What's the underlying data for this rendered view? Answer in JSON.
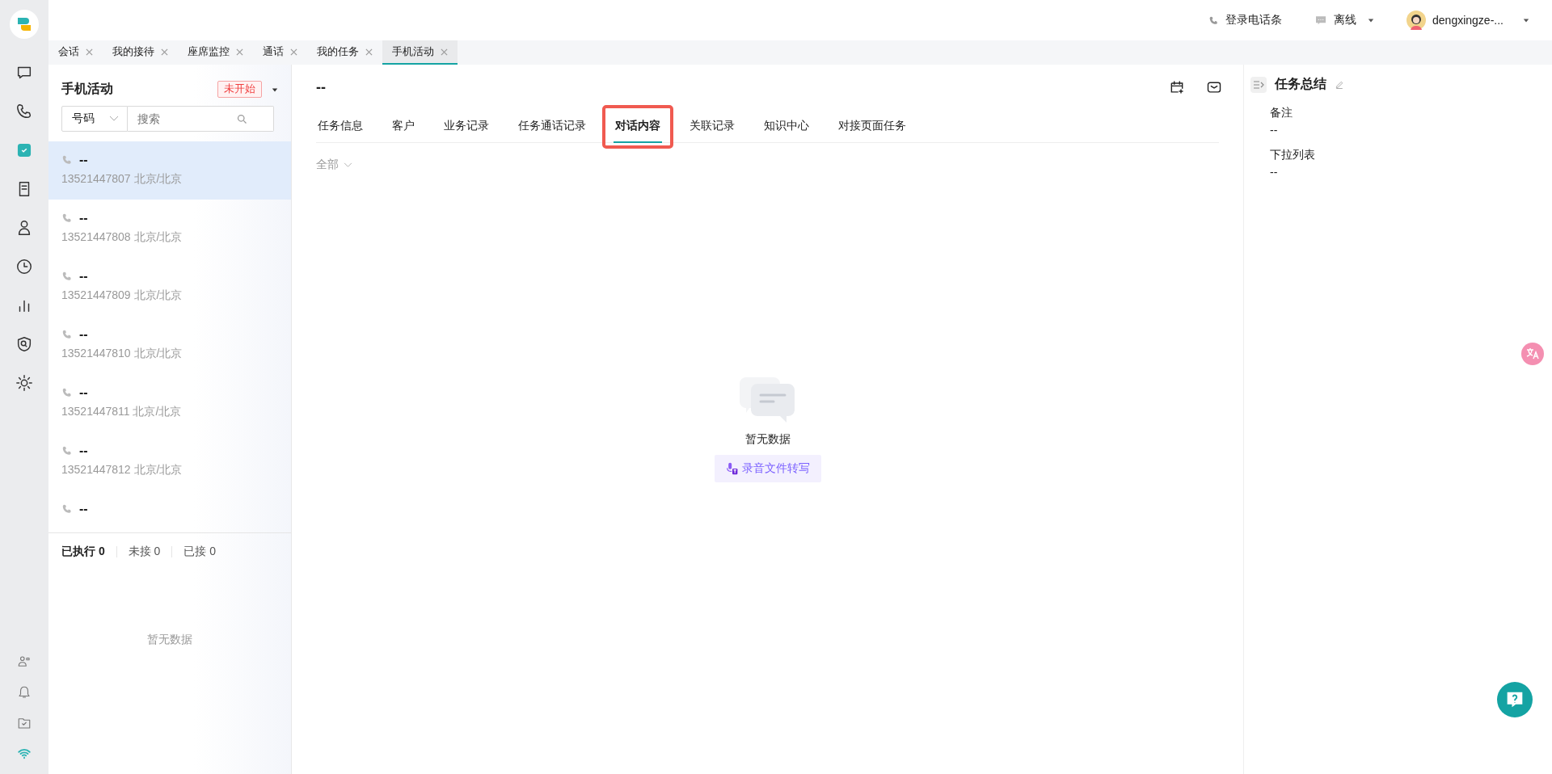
{
  "rail": {
    "items": [
      {
        "kind": "chat",
        "selected": false
      },
      {
        "kind": "phone",
        "selected": false
      },
      {
        "kind": "task",
        "selected": true
      },
      {
        "kind": "document",
        "selected": false
      },
      {
        "kind": "user",
        "selected": false
      },
      {
        "kind": "clock",
        "selected": false
      },
      {
        "kind": "chart",
        "selected": false
      },
      {
        "kind": "shield",
        "selected": false
      },
      {
        "kind": "gear",
        "selected": false
      }
    ],
    "bottom_items": [
      {
        "kind": "user-card"
      },
      {
        "kind": "bell"
      },
      {
        "kind": "folder"
      },
      {
        "kind": "wifi"
      }
    ]
  },
  "top_bar": {
    "phone_login": "登录电话条",
    "status": "离线",
    "user": "dengxingze-..."
  },
  "page_tabs": [
    {
      "label": "会话",
      "selected": false
    },
    {
      "label": "我的接待",
      "selected": false
    },
    {
      "label": "座席监控",
      "selected": false
    },
    {
      "label": "通话",
      "selected": false
    },
    {
      "label": "我的任务",
      "selected": false
    },
    {
      "label": "手机活动",
      "selected": true
    }
  ],
  "list_panel": {
    "title": "手机活动",
    "status_badge": "未开始",
    "search": {
      "type_select": "号码",
      "placeholder": "搜索"
    },
    "items": [
      {
        "title": "--",
        "subtitle": "13521447807 北京/北京",
        "selected": true
      },
      {
        "title": "--",
        "subtitle": "13521447808 北京/北京",
        "selected": false
      },
      {
        "title": "--",
        "subtitle": "13521447809 北京/北京",
        "selected": false
      },
      {
        "title": "--",
        "subtitle": "13521447810 北京/北京",
        "selected": false
      },
      {
        "title": "--",
        "subtitle": "13521447811 北京/北京",
        "selected": false
      },
      {
        "title": "--",
        "subtitle": "13521447812 北京/北京",
        "selected": false
      },
      {
        "title": "--",
        "selected": false
      }
    ],
    "stats": [
      {
        "label": "已执行 0",
        "selected": true
      },
      {
        "label": "未接 0",
        "selected": false
      },
      {
        "label": "已接 0",
        "selected": false
      }
    ],
    "empty_text": "暂无数据"
  },
  "main": {
    "title": "--",
    "tabs": [
      {
        "label": "任务信息",
        "selected": false,
        "highlighted": false
      },
      {
        "label": "客户",
        "selected": false,
        "highlighted": false
      },
      {
        "label": "业务记录",
        "selected": false,
        "highlighted": false
      },
      {
        "label": "任务通话记录",
        "selected": false,
        "highlighted": false
      },
      {
        "label": "对话内容",
        "selected": true,
        "highlighted": true
      },
      {
        "label": "关联记录",
        "selected": false,
        "highlighted": false
      },
      {
        "label": "知识中心",
        "selected": false,
        "highlighted": false
      },
      {
        "label": "对接页面任务",
        "selected": false,
        "highlighted": false
      }
    ],
    "filter": "全部",
    "empty_text": "暂无数据",
    "transcribe_button": "录音文件转写"
  },
  "summary": {
    "title": "任务总结",
    "fields": [
      {
        "label": "备注",
        "value": "--"
      },
      {
        "label": "下拉列表",
        "value": "--"
      }
    ]
  }
}
